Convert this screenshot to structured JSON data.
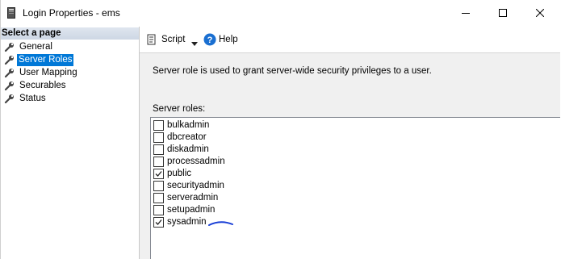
{
  "window": {
    "title": "Login Properties - ems"
  },
  "left_panel": {
    "header": "Select a page",
    "items": [
      {
        "label": "General",
        "selected": false
      },
      {
        "label": "Server Roles",
        "selected": true
      },
      {
        "label": "User Mapping",
        "selected": false
      },
      {
        "label": "Securables",
        "selected": false
      },
      {
        "label": "Status",
        "selected": false
      }
    ]
  },
  "toolbar": {
    "script_label": "Script",
    "help_label": "Help"
  },
  "content": {
    "description": "Server role is used to grant server-wide security privileges to a user.",
    "roles_label": "Server roles:",
    "roles": [
      {
        "name": "bulkadmin",
        "checked": false
      },
      {
        "name": "dbcreator",
        "checked": false
      },
      {
        "name": "diskadmin",
        "checked": false
      },
      {
        "name": "processadmin",
        "checked": false
      },
      {
        "name": "public",
        "checked": true
      },
      {
        "name": "securityadmin",
        "checked": false
      },
      {
        "name": "serveradmin",
        "checked": false
      },
      {
        "name": "setupadmin",
        "checked": false
      },
      {
        "name": "sysadmin",
        "checked": true
      }
    ]
  },
  "colors": {
    "selection": "#0078d7",
    "panel_bg": "#f0f0f0",
    "annotation": "#1a3fd6"
  }
}
